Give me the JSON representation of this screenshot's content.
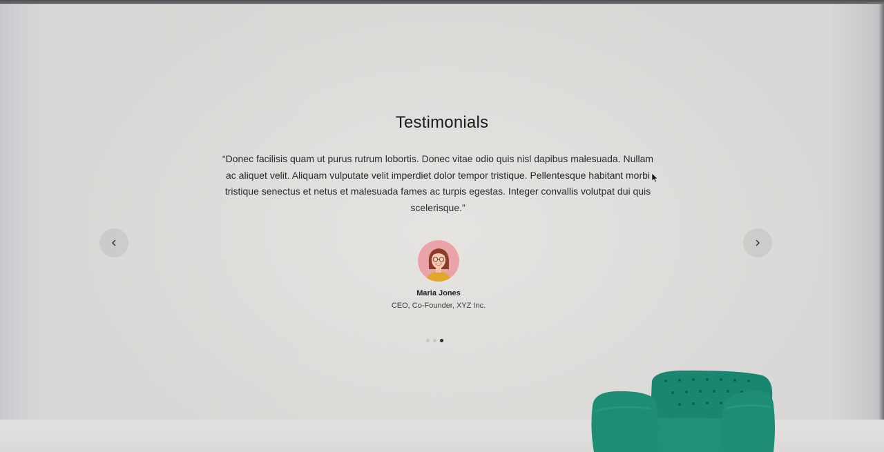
{
  "section": {
    "title": "Testimonials"
  },
  "testimonial": {
    "quote": "“Donec facilisis quam ut purus rutrum lobortis. Donec vitae odio quis nisl dapibus malesuada. Nullam ac aliquet velit. Aliquam vulputate velit imperdiet dolor tempor tristique. Pellentesque habitant morbi tristique senectus et netus et malesuada fames ac turpis egestas. Integer convallis volutpat dui quis scelerisque.”",
    "name": "Maria Jones",
    "role": "CEO, Co-Founder, XYZ Inc."
  },
  "carousel": {
    "prev_icon": "chevron-left-icon",
    "next_icon": "chevron-right-icon",
    "slide_count": 3,
    "active_slide": 3
  },
  "colors": {
    "accent_chair": "#1f8a73",
    "avatar_bg": "#e9a3a8",
    "text_dark": "#1b1b1b"
  }
}
